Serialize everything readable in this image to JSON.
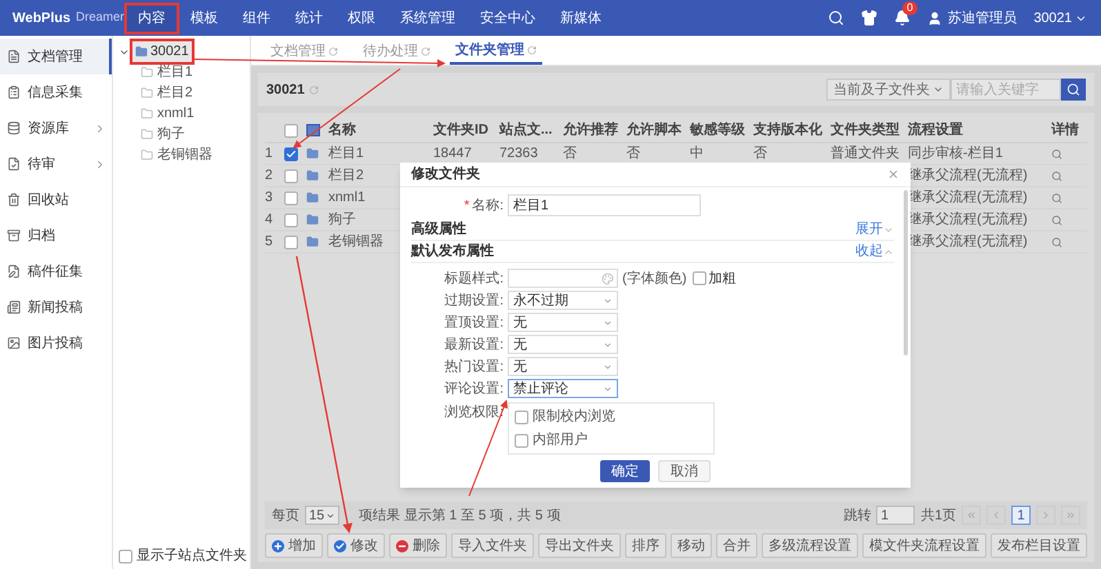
{
  "nav": {
    "brand": "WebPlus",
    "product": "Dreamer",
    "menu": [
      {
        "label": "内容",
        "selected": true
      },
      {
        "label": "模板",
        "selected": false
      },
      {
        "label": "组件",
        "selected": false
      },
      {
        "label": "统计",
        "selected": false
      },
      {
        "label": "权限",
        "selected": false
      },
      {
        "label": "系统管理",
        "selected": false
      },
      {
        "label": "安全中心",
        "selected": false
      },
      {
        "label": "新媒体",
        "selected": false
      }
    ],
    "badge": "0",
    "user": "苏迪管理员",
    "site": "30021"
  },
  "sidebar": {
    "items": [
      {
        "label": "文档管理",
        "selected": true,
        "has_submenu": false
      },
      {
        "label": "信息采集",
        "selected": false,
        "has_submenu": false
      },
      {
        "label": "资源库",
        "selected": false,
        "has_submenu": true
      },
      {
        "label": "待审",
        "selected": false,
        "has_submenu": true
      },
      {
        "label": "回收站",
        "selected": false,
        "has_submenu": false
      },
      {
        "label": "归档",
        "selected": false,
        "has_submenu": false
      },
      {
        "label": "稿件征集",
        "selected": false,
        "has_submenu": false
      },
      {
        "label": "新闻投稿",
        "selected": false,
        "has_submenu": false
      },
      {
        "label": "图片投稿",
        "selected": false,
        "has_submenu": false
      }
    ]
  },
  "tree": {
    "root": {
      "label": "30021",
      "selected": true,
      "expanded": true,
      "children": [
        {
          "label": "栏目1"
        },
        {
          "label": "栏目2"
        },
        {
          "label": "xnml1"
        },
        {
          "label": "狗子"
        },
        {
          "label": "老铜锢器"
        }
      ]
    },
    "show_subsite": {
      "label": "显示子站点文件夹",
      "checked": false
    }
  },
  "tabs": [
    {
      "label": "文档管理",
      "selected": false
    },
    {
      "label": "待办处理",
      "selected": false
    },
    {
      "label": "文件夹管理",
      "selected": true
    }
  ],
  "folder_header": {
    "title": "30021",
    "scope": "当前及子文件夹",
    "search_placeholder": "请输入关键字"
  },
  "table": {
    "select_all": false,
    "columns": [
      "名称",
      "文件夹ID",
      "站点文...",
      "允许推荐",
      "允许脚本",
      "敏感等级",
      "支持版本化",
      "文件夹类型",
      "流程设置",
      "详情"
    ],
    "rows": [
      {
        "index": "1",
        "checked": true,
        "name": "栏目1",
        "info": [
          "18447",
          "72363",
          "否",
          "否",
          "中",
          "否",
          "普通文件夹"
        ],
        "workflow": "同步审核-栏目1"
      },
      {
        "index": "2",
        "checked": false,
        "name": "栏目2",
        "workflow": "继承父流程(无流程)"
      },
      {
        "index": "3",
        "checked": false,
        "name": "xnml1",
        "workflow": "继承父流程(无流程)"
      },
      {
        "index": "4",
        "checked": false,
        "name": "狗子",
        "workflow": "继承父流程(无流程)"
      },
      {
        "index": "5",
        "checked": false,
        "name": "老铜锢器",
        "workflow": "继承父流程(无流程)"
      }
    ]
  },
  "pagination": {
    "per_page_label": "每页",
    "per_page": "15",
    "summary": "项结果 显示第 1 至 5 项，共 5 项",
    "jump_label": "跳转",
    "jump_value": "1",
    "total": "共1页",
    "current": "1"
  },
  "actions": [
    {
      "label": "增加",
      "kind": "add"
    },
    {
      "label": "修改",
      "kind": "edit"
    },
    {
      "label": "删除",
      "kind": "delete"
    },
    {
      "label": "导入文件夹",
      "kind": "plain"
    },
    {
      "label": "导出文件夹",
      "kind": "plain"
    },
    {
      "label": "排序",
      "kind": "plain"
    },
    {
      "label": "移动",
      "kind": "plain"
    },
    {
      "label": "合并",
      "kind": "plain"
    },
    {
      "label": "多级流程设置",
      "kind": "plain"
    },
    {
      "label": "模文件夹流程设置",
      "kind": "plain"
    },
    {
      "label": "发布栏目设置",
      "kind": "plain"
    }
  ],
  "modal": {
    "title": "修改文件夹",
    "name": {
      "label": "名称:",
      "required_mark": "*",
      "value": "栏目1"
    },
    "sections": [
      {
        "title": "高级属性",
        "toggle": "展开",
        "expanded": false
      },
      {
        "title": "默认发布属性",
        "toggle": "收起",
        "expanded": true
      }
    ],
    "fields": [
      {
        "kind": "style",
        "label": "标题样式:",
        "color_hint": "(字体颜色)",
        "bold_label": "加粗",
        "bold": false
      },
      {
        "kind": "select",
        "label": "过期设置:",
        "value": "永不过期",
        "focused": false
      },
      {
        "kind": "select",
        "label": "置顶设置:",
        "value": "无",
        "focused": false
      },
      {
        "kind": "select",
        "label": "最新设置:",
        "value": "无",
        "focused": false
      },
      {
        "kind": "select",
        "label": "热门设置:",
        "value": "无",
        "focused": false
      },
      {
        "kind": "select",
        "label": "评论设置:",
        "value": "禁止评论",
        "focused": true
      },
      {
        "kind": "checklist",
        "label": "浏览权限:",
        "options": [
          {
            "label": "限制校内浏览",
            "checked": false
          },
          {
            "label": "内部用户",
            "checked": false
          }
        ]
      }
    ],
    "confirm": "确定",
    "cancel": "取消"
  }
}
